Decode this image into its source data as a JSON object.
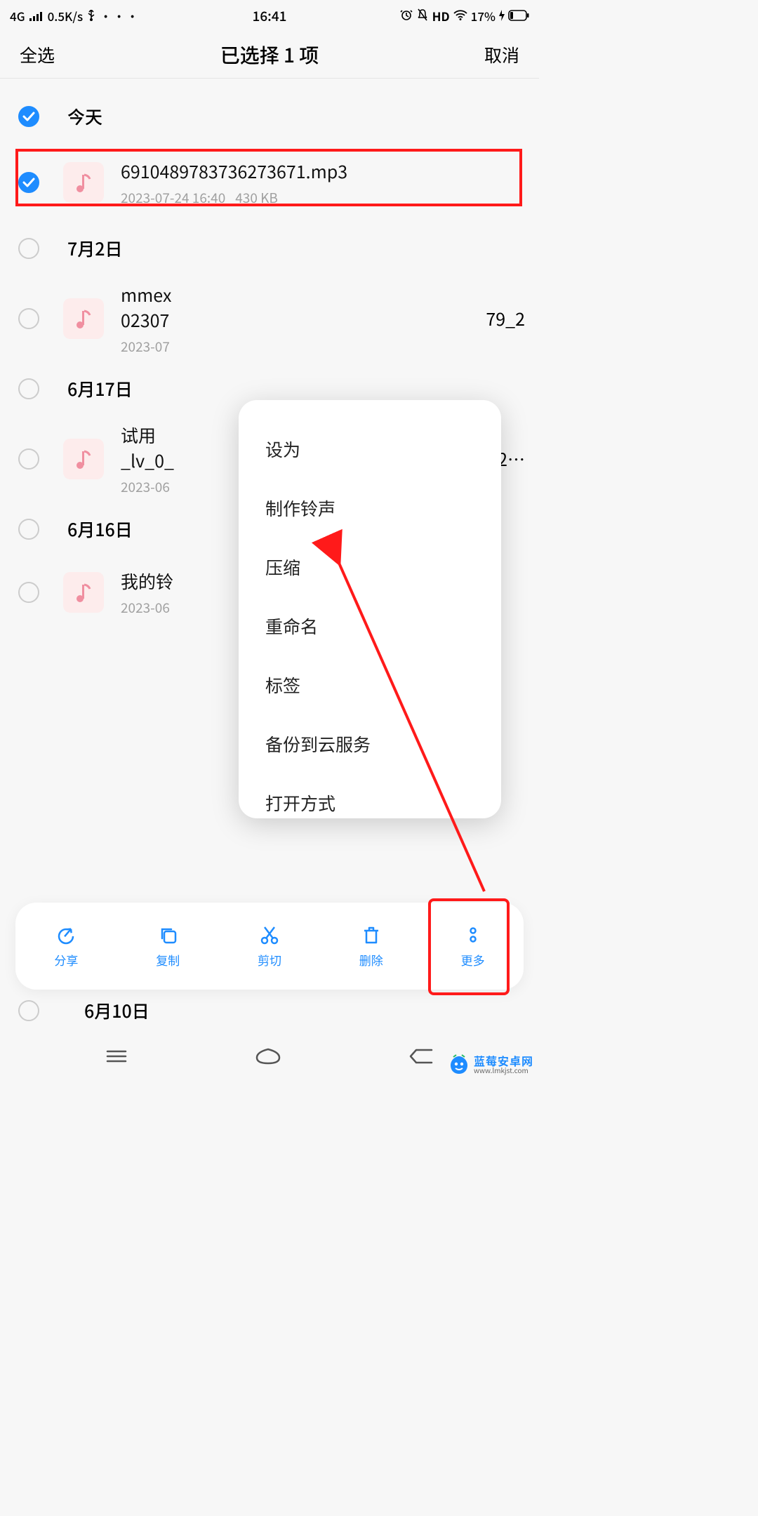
{
  "status": {
    "network": "4G",
    "speed": "0.5K/s",
    "time": "16:41",
    "hd": "HD",
    "battery": "17%"
  },
  "header": {
    "select_all": "全选",
    "title": "已选择 1 项",
    "cancel": "取消"
  },
  "groups": [
    {
      "label": "今天",
      "checked": true
    },
    {
      "label": "7月2日",
      "checked": false
    },
    {
      "label": "6月17日",
      "checked": false
    },
    {
      "label": "6月16日",
      "checked": false
    },
    {
      "label": "6月10日",
      "checked": false
    }
  ],
  "files": [
    {
      "name": "6910489783736273671.mp3",
      "date": "2023-07-24 16:40",
      "size": "430 KB",
      "checked": true,
      "tail": ""
    },
    {
      "name": "mmex",
      "date": "2023-07",
      "size": "",
      "checked": false,
      "tail": "79_2",
      "name2": "02307"
    },
    {
      "name": "试用",
      "date": "2023-06",
      "size": "",
      "checked": false,
      "tail": "2…",
      "name2": "_lv_0_"
    },
    {
      "name": "我的铃",
      "date": "2023-06",
      "size": "",
      "checked": false,
      "tail": ""
    }
  ],
  "popup": {
    "items": [
      "设为",
      "制作铃声",
      "压缩",
      "重命名",
      "标签",
      "备份到云服务",
      "打开方式"
    ]
  },
  "toolbar": {
    "share": "分享",
    "copy": "复制",
    "cut": "剪切",
    "delete": "删除",
    "more": "更多"
  },
  "watermark": {
    "main": "蓝莓安卓网",
    "sub": "www.lmkjst.com"
  }
}
